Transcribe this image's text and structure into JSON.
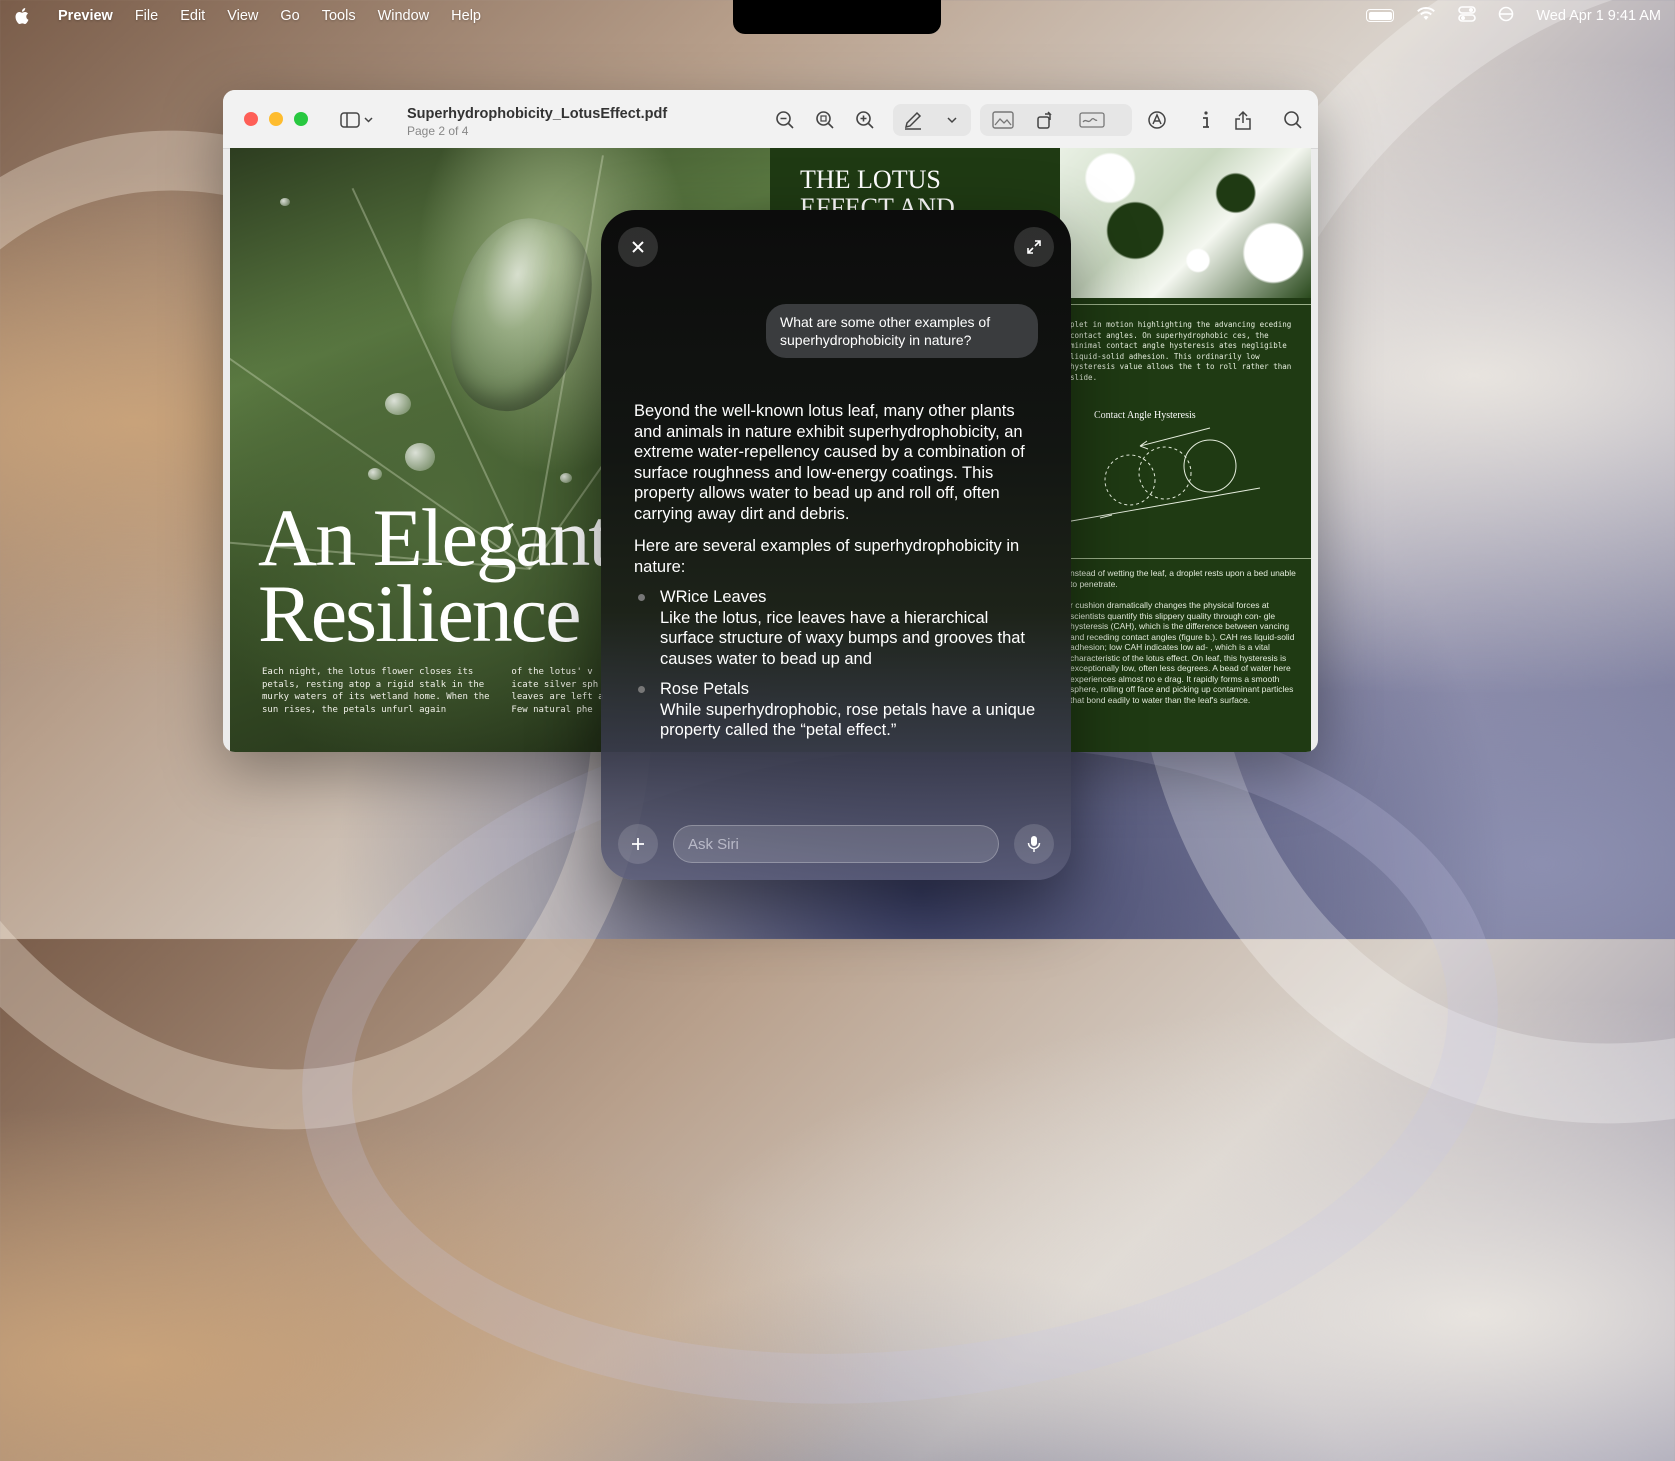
{
  "menubar": {
    "app_name": "Preview",
    "items": [
      "File",
      "Edit",
      "View",
      "Go",
      "Tools",
      "Window",
      "Help"
    ],
    "datetime": "Wed Apr 1  9:41 AM",
    "status_icons": [
      "battery-icon",
      "wifi-icon",
      "control-center-icon",
      "focus-icon"
    ]
  },
  "window": {
    "title": "Superhydrophobicity_LotusEffect.pdf",
    "subtitle": "Page 2 of 4",
    "toolbar_icons": [
      "sidebar-icon",
      "zoom-out-icon",
      "zoom-fit-icon",
      "zoom-in-icon",
      "markup-pen-icon",
      "chevron-down-icon",
      "image-adjust-icon",
      "rotate-icon",
      "sign-icon",
      "annotate-icon",
      "info-icon",
      "share-icon",
      "search-icon"
    ]
  },
  "document": {
    "headline_line1": "An Elegant",
    "headline_line2": "Resilience",
    "caption_left": "Each night, the lotus flower closes its petals, resting atop a rigid stalk in the murky waters of its wetland home. When the sun rises, the petals unfurl again",
    "caption_right": "of the lotus' v icate silver sph leaves are left a Few natural phe",
    "right_title": "THE LOTUS EFFECT AND ITS",
    "right_para1": "plet in motion highlighting the advancing eceding contact angles. On superhydrophobic ces, the minimal contact angle hysteresis ates negligible liquid-solid adhesion. This ordinarily low hysteresis value allows the t to roll rather than slide.",
    "figure_title": "Contact Angle Hysteresis",
    "right_para2": "nstead of wetting the leaf, a droplet rests upon a bed unable to penetrate.",
    "right_para3": "r cushion dramatically changes the physical forces at scientists quantify this slippery quality through con- gle hysteresis (CAH), which is the difference between vancing and receding contact angles (figure b.). CAH res liquid-solid adhesion; low CAH indicates low ad- , which is a vital characteristic of the lotus effect. On leaf, this hysteresis is exceptionally low, often less degrees. A bead of water here experiences almost no e drag. It rapidly forms a smooth sphere, rolling off face and picking up contaminant particles that bond eadily to water than the leaf's surface."
  },
  "siri": {
    "user_query": "What are some other examples of superhydrophobicity in nature?",
    "response_intro": "Beyond the well-known lotus leaf, many other plants and animals in nature exhibit superhydrophobicity, an extreme water-repellency caused by a combination of surface roughness and low-energy coatings. This property allows water to bead up and roll off, often carrying away dirt and debris.",
    "response_intro2": "Here are several examples of superhydrophobicity in nature:",
    "examples": [
      {
        "title": "WRice Leaves",
        "text": "Like the lotus, rice leaves have a hierarchical surface structure of waxy bumps and grooves that causes water to bead up and"
      },
      {
        "title": "Rose Petals",
        "text": "While superhydrophobic, rose petals have a unique property called the “petal effect.”"
      }
    ],
    "input_placeholder": "Ask Siri",
    "input_value": ""
  }
}
